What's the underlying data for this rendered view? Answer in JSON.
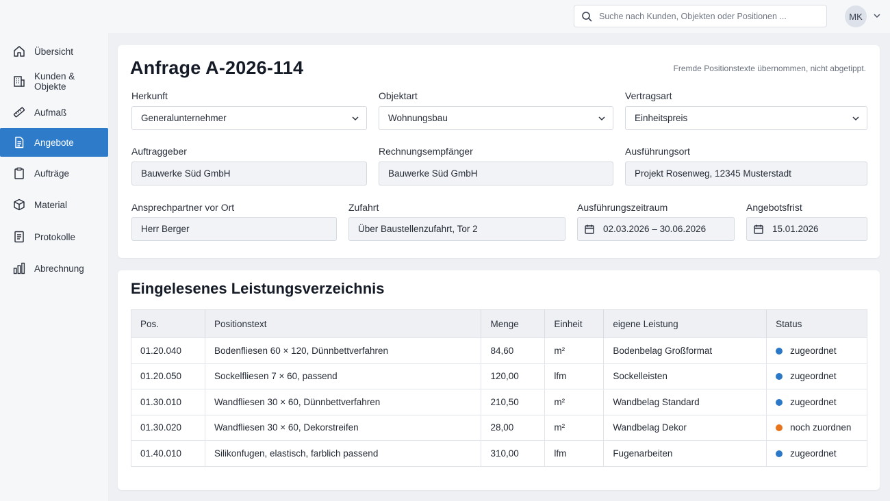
{
  "search": {
    "placeholder": "Suche nach Kunden, Objekten oder Positionen ..."
  },
  "user": {
    "initials": "MK"
  },
  "sidebar": {
    "items": [
      {
        "label": "Übersicht",
        "icon": "home-icon"
      },
      {
        "label": "Kunden & Objekte",
        "icon": "building-icon"
      },
      {
        "label": "Aufmaß",
        "icon": "ruler-icon"
      },
      {
        "label": "Angebote",
        "icon": "document-icon",
        "active": true
      },
      {
        "label": "Aufträge",
        "icon": "clipboard-icon"
      },
      {
        "label": "Material",
        "icon": "box-icon"
      },
      {
        "label": "Protokolle",
        "icon": "list-icon"
      },
      {
        "label": "Abrechnung",
        "icon": "bar-chart-icon"
      }
    ]
  },
  "inquiry": {
    "title": "Anfrage A-2026-114",
    "note": "Fremde Positionstexte übernommen, nicht abgetippt.",
    "fields": {
      "herkunft": {
        "label": "Herkunft",
        "value": "Generalunternehmer"
      },
      "objektart": {
        "label": "Objektart",
        "value": "Wohnungsbau"
      },
      "vertragsart": {
        "label": "Vertragsart",
        "value": "Einheitspreis"
      },
      "auftraggeber": {
        "label": "Auftraggeber",
        "value": "Bauwerke Süd GmbH"
      },
      "rechnungsempfaenger": {
        "label": "Rechnungsempfänger",
        "value": "Bauwerke Süd GmbH"
      },
      "ausfuehrungsort": {
        "label": "Ausführungsort",
        "value": "Projekt Rosenweg, 12345 Musterstadt"
      },
      "ansprechpartner": {
        "label": "Ansprechpartner vor Ort",
        "value": "Herr Berger"
      },
      "zufahrt": {
        "label": "Zufahrt",
        "value": "Über Baustellenzufahrt, Tor 2"
      },
      "zeitraum": {
        "label": "Ausführungszeitraum",
        "value": "02.03.2026 – 30.06.2026"
      },
      "frist": {
        "label": "Angebotsfrist",
        "value": "15.01.2026"
      }
    }
  },
  "lv": {
    "title": "Eingelesenes Leistungsverzeichnis",
    "columns": [
      "Pos.",
      "Positionstext",
      "Menge",
      "Einheit",
      "eigene Leistung",
      "Status"
    ],
    "rows": [
      {
        "pos": "01.20.040",
        "text": "Bodenfliesen 60 × 120, Dünnbettverfahren",
        "menge": "84,60",
        "einheit": "m²",
        "leistung": "Bodenbelag Großformat",
        "status": "zugeordnet",
        "status_color": "#2a78c7"
      },
      {
        "pos": "01.20.050",
        "text": "Sockelfliesen 7 × 60, passend",
        "menge": "120,00",
        "einheit": "lfm",
        "leistung": "Sockelleisten",
        "status": "zugeordnet",
        "status_color": "#2a78c7"
      },
      {
        "pos": "01.30.010",
        "text": "Wandfliesen 30 × 60, Dünnbettverfahren",
        "menge": "210,50",
        "einheit": "m²",
        "leistung": "Wandbelag Standard",
        "status": "zugeordnet",
        "status_color": "#2a78c7"
      },
      {
        "pos": "01.30.020",
        "text": "Wandfliesen 30 × 60, Dekorstreifen",
        "menge": "28,00",
        "einheit": "m²",
        "leistung": "Wandbelag Dekor",
        "status": "noch zuordnen",
        "status_color": "#e8741c"
      },
      {
        "pos": "01.40.010",
        "text": "Silikonfugen, elastisch, farblich passend",
        "menge": "310,00",
        "einheit": "lfm",
        "leistung": "Fugenarbeiten",
        "status": "zugeordnet",
        "status_color": "#2a78c7"
      }
    ]
  },
  "colors": {
    "accent": "#2e7cc9",
    "status_ok": "#2a78c7",
    "status_todo": "#e8741c"
  }
}
